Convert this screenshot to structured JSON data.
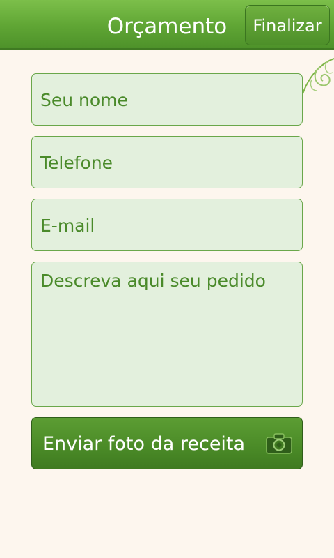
{
  "header": {
    "title": "Orçamento",
    "finish_label": "Finalizar"
  },
  "form": {
    "name_placeholder": "Seu nome",
    "phone_placeholder": "Telefone",
    "email_placeholder": "E-mail",
    "description_placeholder": "Descreva aqui seu pedido"
  },
  "photo_button": {
    "label": "Enviar foto da receita",
    "icon": "camera-icon"
  },
  "colors": {
    "background": "#fdf6ee",
    "brand_green": "#5fa534",
    "field_background": "#e3f0dd",
    "field_text": "#4a8a2a"
  }
}
